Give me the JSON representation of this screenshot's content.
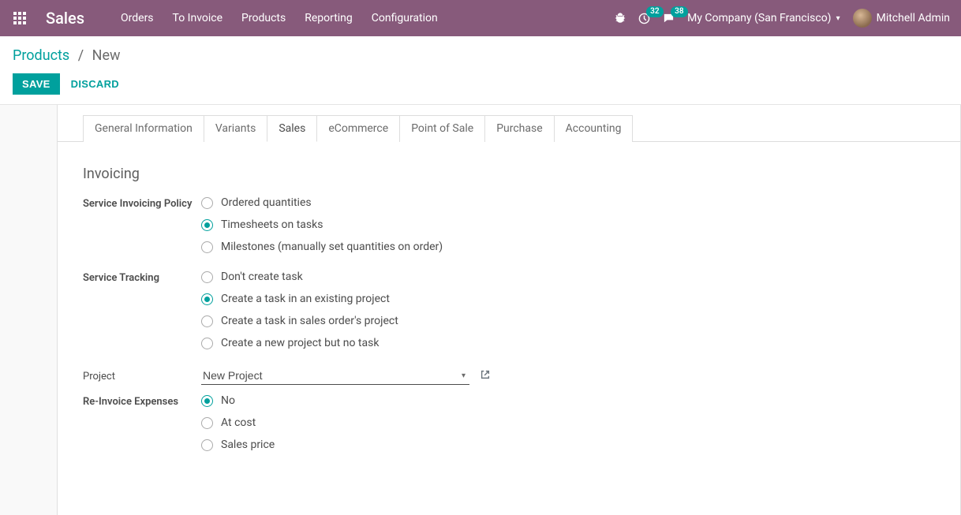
{
  "topbar": {
    "brand": "Sales",
    "menu": [
      "Orders",
      "To Invoice",
      "Products",
      "Reporting",
      "Configuration"
    ],
    "tray": {
      "activity_count": "32",
      "message_count": "38"
    },
    "company": "My Company (San Francisco)",
    "user": "Mitchell Admin"
  },
  "breadcrumb": {
    "root": "Products",
    "current": "New"
  },
  "actions": {
    "save": "Save",
    "discard": "Discard"
  },
  "tabs": [
    "General Information",
    "Variants",
    "Sales",
    "eCommerce",
    "Point of Sale",
    "Purchase",
    "Accounting"
  ],
  "active_tab": "Sales",
  "section": {
    "title": "Invoicing",
    "fields": {
      "invoicing_policy": {
        "label": "Service Invoicing Policy",
        "options": [
          "Ordered quantities",
          "Timesheets on tasks",
          "Milestones (manually set quantities on order)"
        ],
        "selected": "Timesheets on tasks"
      },
      "service_tracking": {
        "label": "Service Tracking",
        "options": [
          "Don't create task",
          "Create a task in an existing project",
          "Create a task in sales order's project",
          "Create a new project but no task"
        ],
        "selected": "Create a task in an existing project"
      },
      "project": {
        "label": "Project",
        "value": "New Project"
      },
      "reinvoice": {
        "label": "Re-Invoice Expenses",
        "options": [
          "No",
          "At cost",
          "Sales price"
        ],
        "selected": "No"
      }
    }
  }
}
